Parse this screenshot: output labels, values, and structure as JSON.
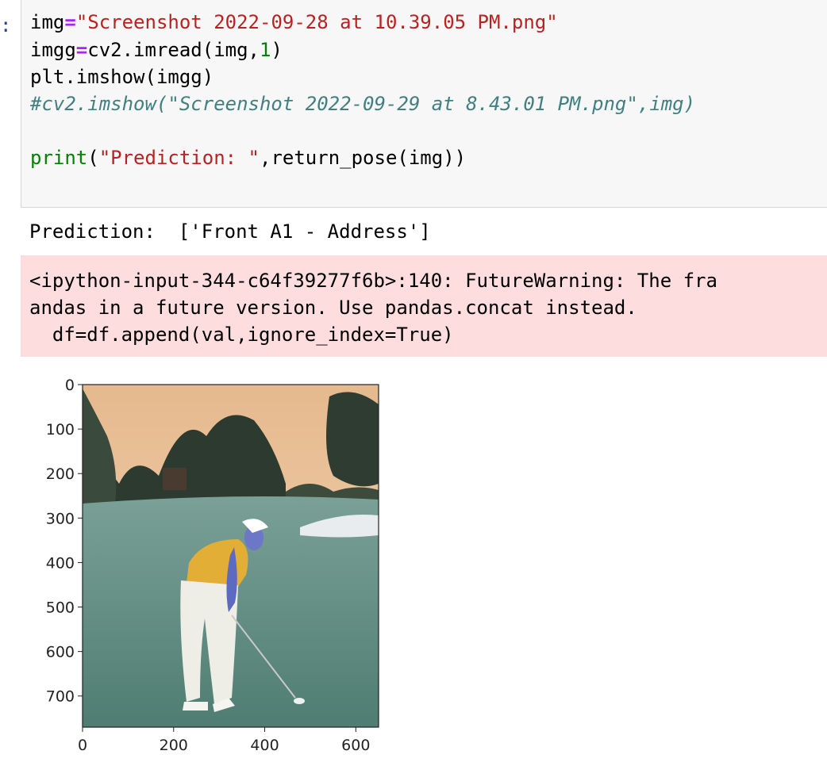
{
  "cell": {
    "prompt": ":",
    "line1": {
      "var": "img",
      "op": "=",
      "str": "\"Screenshot 2022-09-28 at 10.39.05 PM.png\""
    },
    "line2": {
      "var": "imgg",
      "op": "=",
      "call": "cv2.imread(img,",
      "num": "1",
      "close": ")"
    },
    "line3": "plt.imshow(imgg)",
    "line4": "#cv2.imshow(\"Screenshot 2022-09-29 at 8.43.01 PM.png\",img)",
    "line5": {
      "kw": "print",
      "open": "(",
      "str": "\"Prediction: \"",
      "rest": ",return_pose(img))"
    }
  },
  "output": {
    "stdout": "Prediction:  ['Front A1 - Address']",
    "stderr": [
      "<ipython-input-344-c64f39277f6b>:140: FutureWarning: The fra",
      "andas in a future version. Use pandas.concat instead.",
      "  df=df.append(val,ignore_index=True)"
    ]
  },
  "chart_data": {
    "type": "image",
    "y_ticks": [
      "0",
      "100",
      "200",
      "300",
      "400",
      "500",
      "600",
      "700"
    ],
    "y_values": [
      0,
      100,
      200,
      300,
      400,
      500,
      600,
      700
    ],
    "x_ticks": [
      "0",
      "200",
      "400",
      "600"
    ],
    "x_values": [
      0,
      200,
      400,
      600
    ],
    "xlim": [
      0,
      650
    ],
    "ylim": [
      770,
      0
    ]
  },
  "colors": {
    "sky": "#e8c39d",
    "grass": "#5f8b80",
    "shirt": "#e5b33b",
    "pants": "#efefe8",
    "trees": "#2e3a2f"
  }
}
